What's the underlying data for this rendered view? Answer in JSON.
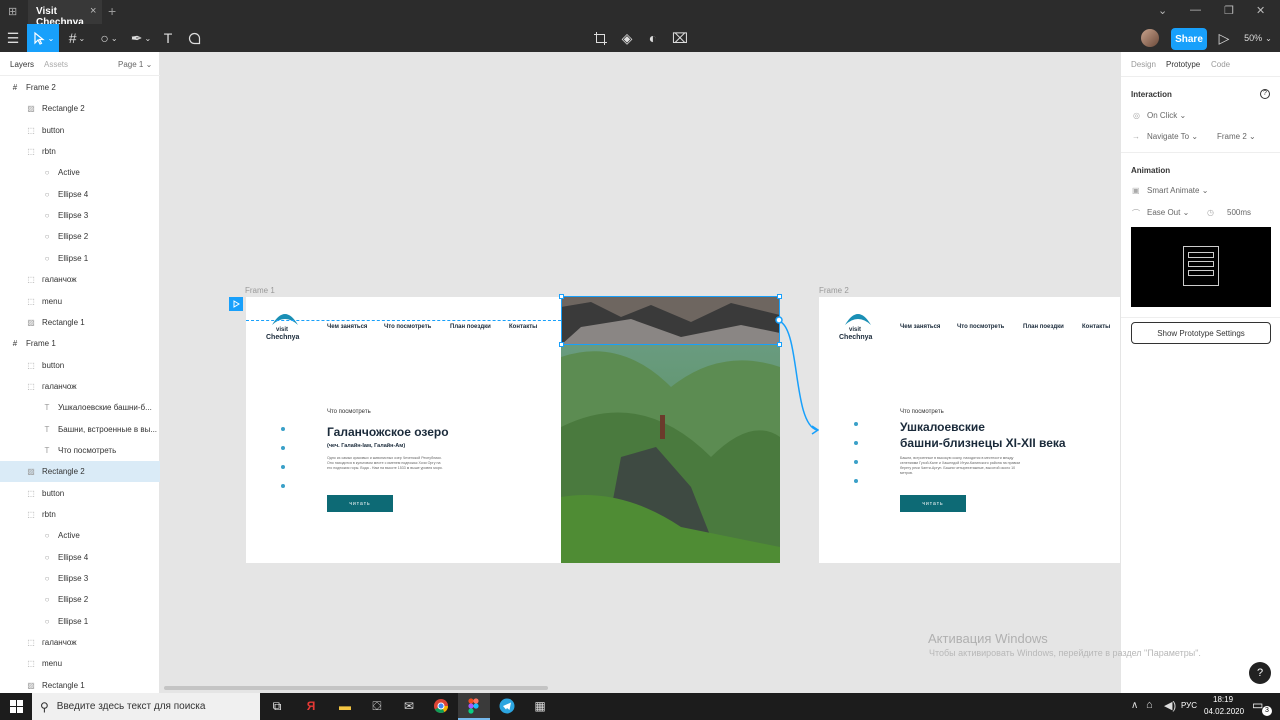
{
  "titlebar": {
    "tab_title": "Visit Chechnya",
    "tab_close": "×",
    "new_tab": "+",
    "minimize": "⌄",
    "min2": "—",
    "restore": "❐",
    "close": "✕"
  },
  "toolbar": {
    "share_label": "Share",
    "zoom": "50%",
    "play": "▷"
  },
  "left_panel": {
    "tabs": {
      "layers": "Layers",
      "assets": "Assets",
      "page": "Page 1"
    },
    "layers": [
      {
        "label": "Frame 2",
        "type": "frame",
        "indent": 0
      },
      {
        "label": "Rectangle 2",
        "type": "image",
        "indent": 1
      },
      {
        "label": "button",
        "type": "component",
        "indent": 1
      },
      {
        "label": "rbtn",
        "type": "component",
        "indent": 1
      },
      {
        "label": "Active",
        "type": "ellipse",
        "indent": 2
      },
      {
        "label": "Ellipse 4",
        "type": "ellipse",
        "indent": 2
      },
      {
        "label": "Ellipse 3",
        "type": "ellipse",
        "indent": 2
      },
      {
        "label": "Ellipse 2",
        "type": "ellipse",
        "indent": 2
      },
      {
        "label": "Ellipse 1",
        "type": "ellipse",
        "indent": 2
      },
      {
        "label": "галанчож",
        "type": "component",
        "indent": 1
      },
      {
        "label": "menu",
        "type": "component",
        "indent": 1
      },
      {
        "label": "Rectangle 1",
        "type": "image",
        "indent": 1
      },
      {
        "label": "Frame 1",
        "type": "frame",
        "indent": 0
      },
      {
        "label": "button",
        "type": "component",
        "indent": 1
      },
      {
        "label": "галанчож",
        "type": "component",
        "indent": 1
      },
      {
        "label": "Ушкалоевские башни-б...",
        "type": "text",
        "indent": 2
      },
      {
        "label": "Башни, встроенные в вы...",
        "type": "text",
        "indent": 2
      },
      {
        "label": "Что посмотреть",
        "type": "text",
        "indent": 2
      },
      {
        "label": "Rectangle 2",
        "type": "image",
        "indent": 1,
        "selected": true
      },
      {
        "label": "button",
        "type": "component",
        "indent": 1
      },
      {
        "label": "rbtn",
        "type": "component",
        "indent": 1
      },
      {
        "label": "Active",
        "type": "ellipse",
        "indent": 2
      },
      {
        "label": "Ellipse 4",
        "type": "ellipse",
        "indent": 2
      },
      {
        "label": "Ellipse 3",
        "type": "ellipse",
        "indent": 2
      },
      {
        "label": "Ellipse 2",
        "type": "ellipse",
        "indent": 2
      },
      {
        "label": "Ellipse 1",
        "type": "ellipse",
        "indent": 2
      },
      {
        "label": "галанчож",
        "type": "component",
        "indent": 1
      },
      {
        "label": "menu",
        "type": "component",
        "indent": 1
      },
      {
        "label": "Rectangle 1",
        "type": "image",
        "indent": 1
      }
    ]
  },
  "canvas": {
    "frame1": {
      "label": "Frame 1",
      "logo_line1": "visit",
      "logo_line2": "Chechnya",
      "nav": [
        "Чем заняться",
        "Что посмотреть",
        "План поездки",
        "Контакты"
      ],
      "eyebrow": "Что посмотреть",
      "title": "Галанчожское озеро",
      "subtitle": "(чеч. Галайн-Іам, Галайн-Ам)",
      "body": "Одно из самых красивых и живописных озер Чеченской Республики. Оно находится в культовом месте с именем подножья Хочи Оргу на его подножия горы. Вода - Нам на высоте 1533 м выше уровня моря.",
      "button": "читать"
    },
    "frame2": {
      "label": "Frame 2",
      "logo_line1": "visit",
      "logo_line2": "Chechnya",
      "nav": [
        "Чем заняться",
        "Что посмотреть",
        "План поездки",
        "Контакты"
      ],
      "eyebrow": "Что посмотреть",
      "title_line1": "Ушкалоевские",
      "title_line2": "башни-близнецы XI-XII века",
      "body": "Башни, встроенные в высокую скалу, находятся в местности между селениями Гухой-Кале и Хашелдой Итум-Калинского района на правом берегу реки Чанти-Аргун. Башни четырехэтажные, высотой около 10 метров.",
      "button": "читать"
    }
  },
  "right_panel": {
    "tabs": [
      "Design",
      "Prototype",
      "Code"
    ],
    "interaction_title": "Interaction",
    "trigger": "On Click",
    "action": "Navigate To",
    "destination": "Frame 2",
    "animation_title": "Animation",
    "animation_type": "Smart Animate",
    "easing": "Ease Out",
    "duration": "500ms",
    "settings_button": "Show Prototype Settings"
  },
  "watermark": {
    "line1": "Активация Windows",
    "line2": "Чтобы активировать Windows, перейдите в раздел \"Параметры\"."
  },
  "help": "?",
  "taskbar": {
    "search_placeholder": "Введите здесь текст для поиска",
    "lang": "РУС",
    "time": "18:19",
    "date": "04.02.2020",
    "badge": "3"
  }
}
